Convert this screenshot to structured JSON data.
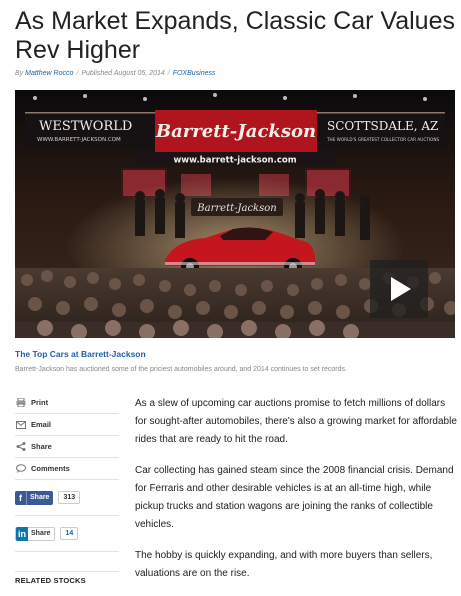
{
  "article": {
    "headline": "As Market Expands, Classic Car Values Rev Higher",
    "byline_prefix": "By",
    "author": "Matthew Rocco",
    "published": "Published August 05, 2014",
    "source": "FOXBusiness"
  },
  "video": {
    "banner_left_title": "WESTWORLD",
    "banner_left_url": "WWW.BARRETT-JACKSON.COM",
    "banner_logo": "Barrett-Jackson",
    "banner_right_title": "SCOTTSDALE, AZ",
    "banner_right_tagline": "THE WORLD'S GREATEST COLLECTOR CAR AUCTIONS",
    "banner_url": "www.barrett-jackson.com",
    "stage_logo": "Barrett-Jackson",
    "title": "The Top Cars at Barrett-Jackson",
    "caption": "Barrett-Jackson has auctioned some of the priciest automobiles around, and 2014 continues to set records."
  },
  "tools": {
    "print": "Print",
    "email": "Email",
    "share": "Share",
    "comments": "Comments",
    "fb_share": "Share",
    "fb_count": "313",
    "li_share": "Share",
    "li_count": "14",
    "related": "RELATED STOCKS"
  },
  "body": {
    "p1": "As a slew of upcoming car auctions promise to fetch millions of dollars for sought-after automobiles, there's also a growing market for affordable rides that are ready to hit the road.",
    "p2": "Car collecting has gained steam since the 2008 financial crisis. Demand for Ferraris and other desirable vehicles is at an all-time high, while pickup trucks and station wagons are joining the ranks of collectible vehicles.",
    "p3": "The hobby is quickly expanding, and with more buyers than sellers, valuations are on the rise."
  },
  "colors": {
    "link": "#1f5fa8",
    "banner_red": "#b0141c",
    "car_red": "#c4161c",
    "facebook": "#3b5998",
    "linkedin": "#0e76a8"
  }
}
